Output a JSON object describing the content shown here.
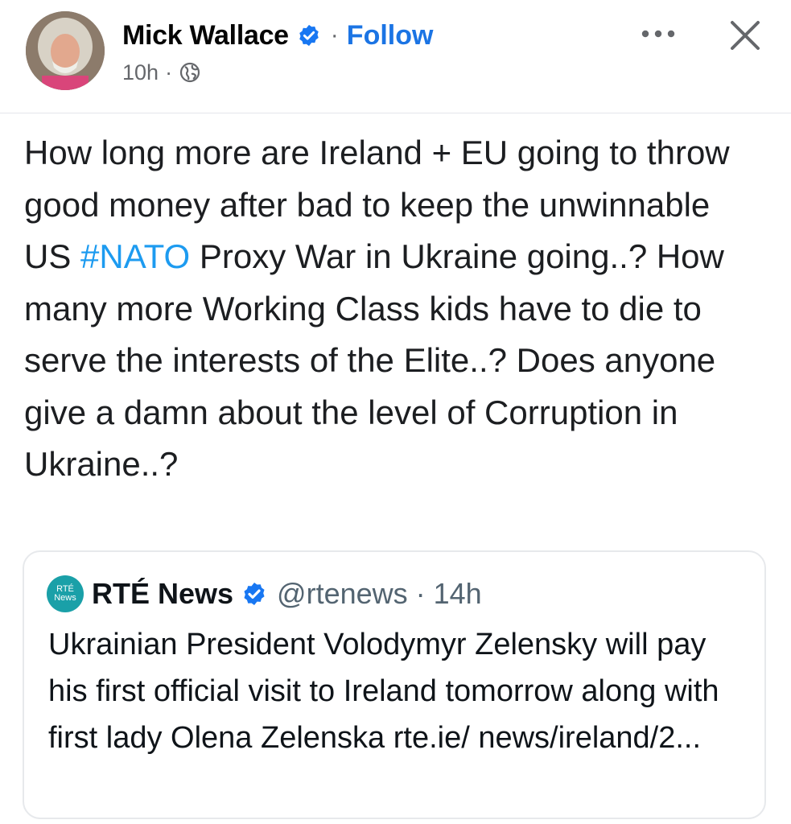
{
  "post": {
    "author_name": "Mick Wallace",
    "separator": "·",
    "follow_label": "Follow",
    "timestamp": "10h",
    "meta_separator": "·",
    "audience_icon": "globe-icon",
    "more_icon": "more-options-icon",
    "close_icon": "close-icon",
    "body_before_hashtag": "How long more are Ireland + EU going to throw good money after bad to keep the unwinnable US ",
    "hashtag": "#NATO",
    "body_after_hashtag": " Proxy War in Ukraine going..? How many more Working Class kids have to die to serve the interests of the Elite..? Does anyone give a damn about the level of Corruption in Ukraine..?"
  },
  "quote": {
    "logo_line1": "RTÉ",
    "logo_line2": "News",
    "name": "RTÉ News",
    "handle_time": "@rtenews · 14h",
    "text": "Ukrainian President Volodymyr Zelensky will pay his first official visit to Ireland tomorrow along with first lady Olena Zelenska rte.ie/ news/ireland/2..."
  },
  "colors": {
    "link": "#1b74e4",
    "hashtag": "#1d9bf0",
    "verified": "#1877f2",
    "quote_logo": "#1aa0a8"
  }
}
